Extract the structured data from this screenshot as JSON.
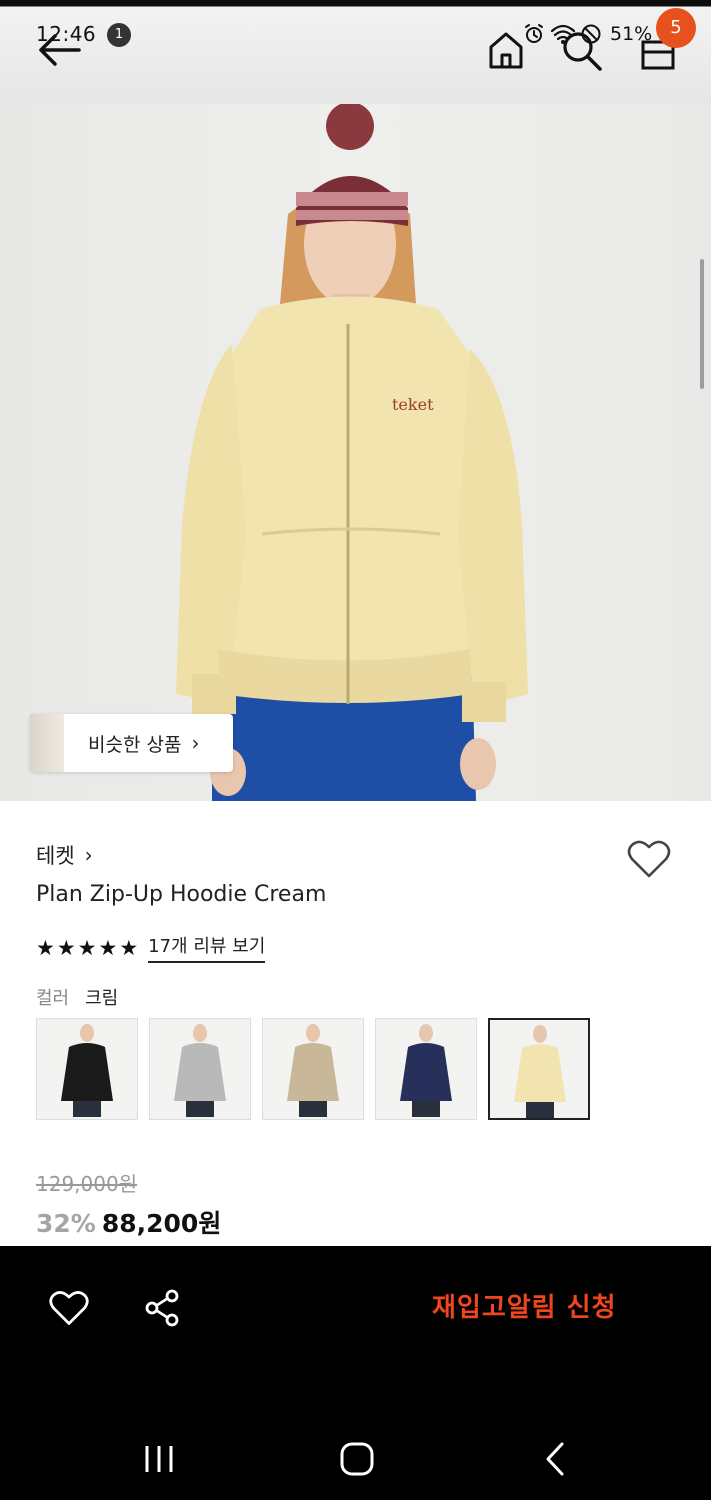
{
  "status_bar": {
    "time": "12:46",
    "notification_count": "1",
    "battery": "51%"
  },
  "app_bar": {
    "cart_count": "5"
  },
  "photo": {
    "similar_label": "비슷한 상품"
  },
  "product": {
    "brand": "테켓",
    "name": "Plan Zip-Up Hoodie Cream",
    "rating_stars": 5,
    "review_link": "17개 리뷰 보기",
    "color_label": "컬러",
    "color_value": "크림",
    "color_swatches": [
      {
        "name": "black",
        "hex": "#1a1a1a",
        "selected": false
      },
      {
        "name": "gray",
        "hex": "#b9b9b9",
        "selected": false
      },
      {
        "name": "beige-black",
        "hex": "#c9b79a",
        "selected": false
      },
      {
        "name": "navy-gray",
        "hex": "#26305a",
        "selected": false
      },
      {
        "name": "cream",
        "hex": "#f1e4b0",
        "selected": true
      }
    ],
    "original_price": "129,000원",
    "discount": "32%",
    "sale_price": "88,200원"
  },
  "bottom_bar": {
    "restock_label": "재입고알림 신청"
  },
  "colors": {
    "accent": "#f0461f",
    "badge": "#e8501d"
  }
}
